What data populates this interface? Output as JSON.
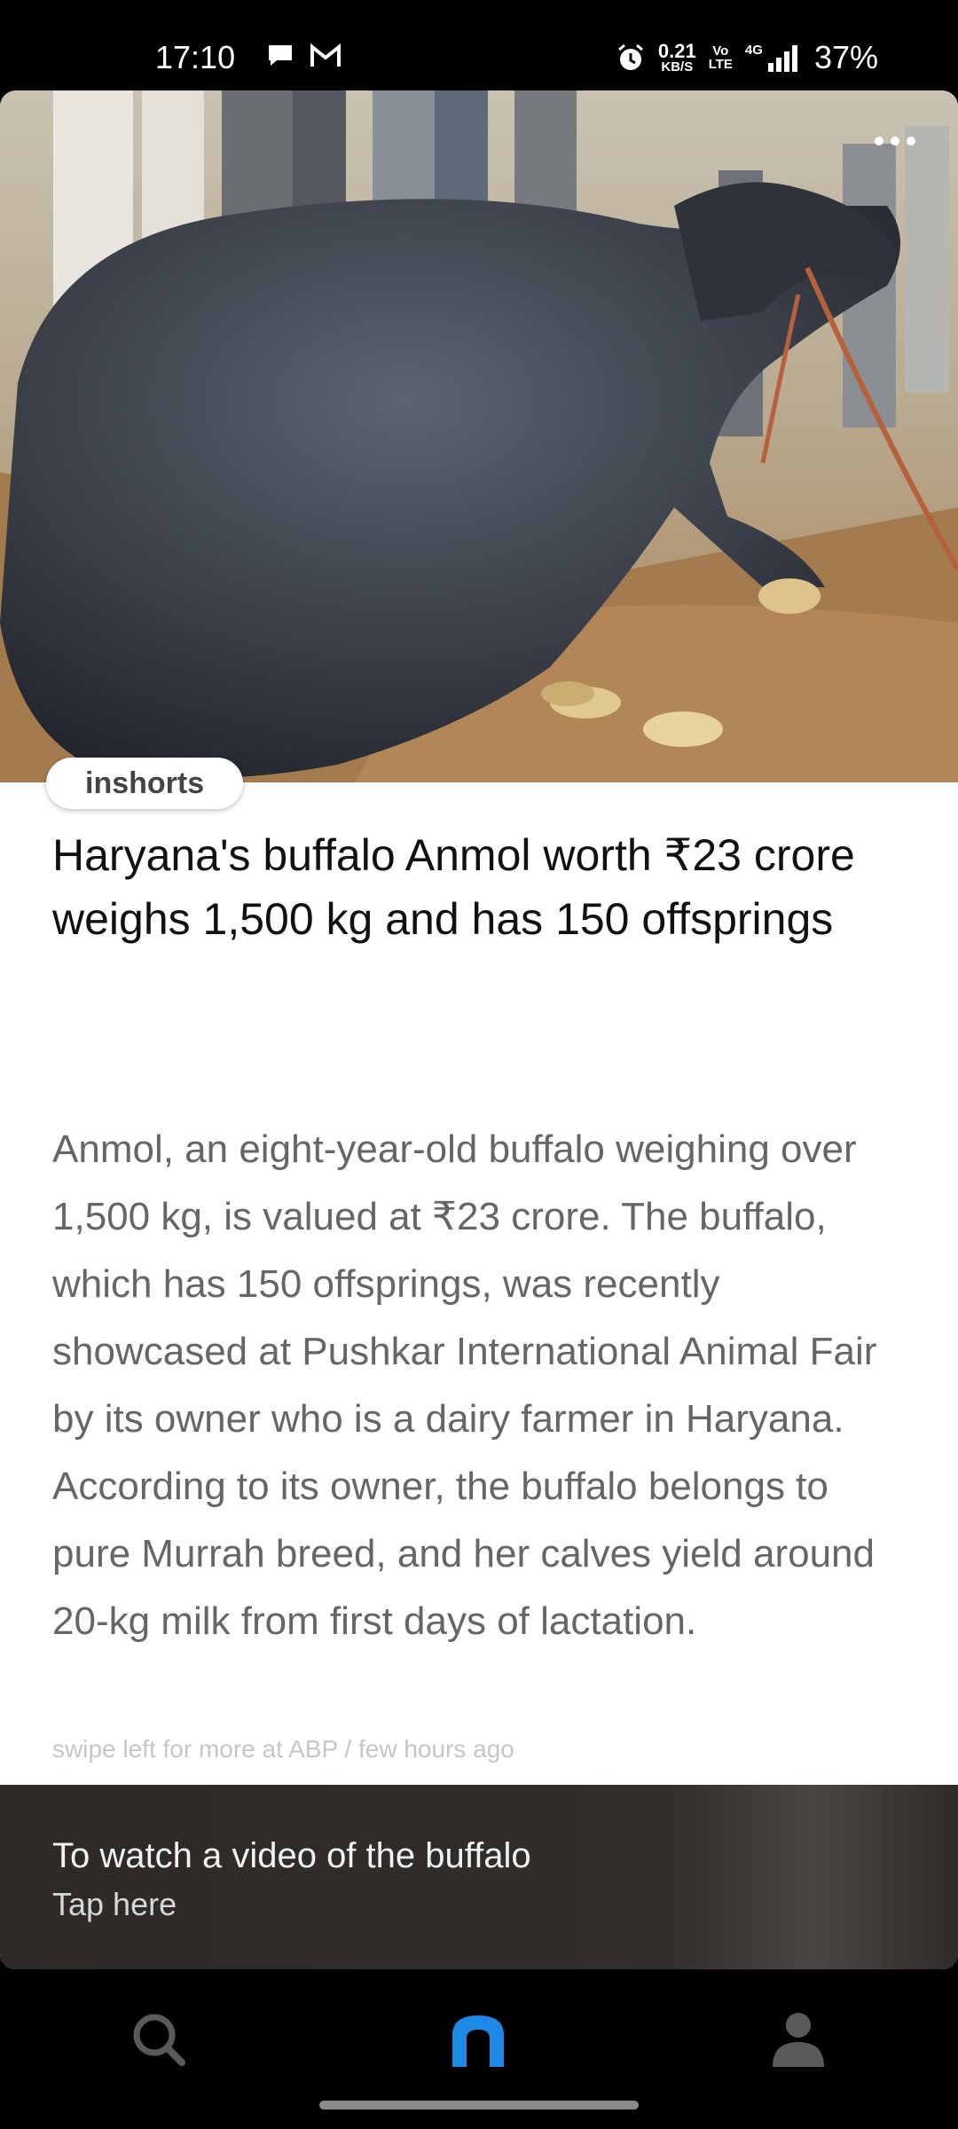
{
  "status_bar": {
    "time": "17:10",
    "net_speed_value": "0.21",
    "net_speed_unit": "KB/S",
    "volte_top": "Vo",
    "volte_bottom": "LTE",
    "network_type": "4G",
    "battery": "37%",
    "icons": [
      "chat-bubble-icon",
      "gmail-icon",
      "alarm-icon",
      "signal-icon"
    ]
  },
  "article": {
    "brand": "inshorts",
    "headline": "Haryana's buffalo Anmol worth ₹23 crore weighs 1,500 kg and has 150 offsprings",
    "body": "Anmol, an eight-year-old buffalo weighing over 1,500 kg, is valued at ₹23 crore. The buffalo, which has 150 offsprings, was recently showcased at Pushkar International Animal Fair by its owner who is a dairy farmer in Haryana. According to its owner, the buffalo belongs to pure Murrah breed, and her calves yield around 20-kg milk from first days of lactation.",
    "meta": "swipe left for more at ABP / few hours ago"
  },
  "promo": {
    "title": "To watch a video of the buffalo",
    "subtitle": "Tap here"
  },
  "bottom_nav": {
    "items": [
      "search-icon",
      "home-icon",
      "profile-icon"
    ],
    "active": "home-icon",
    "active_color": "#1e88e5"
  }
}
